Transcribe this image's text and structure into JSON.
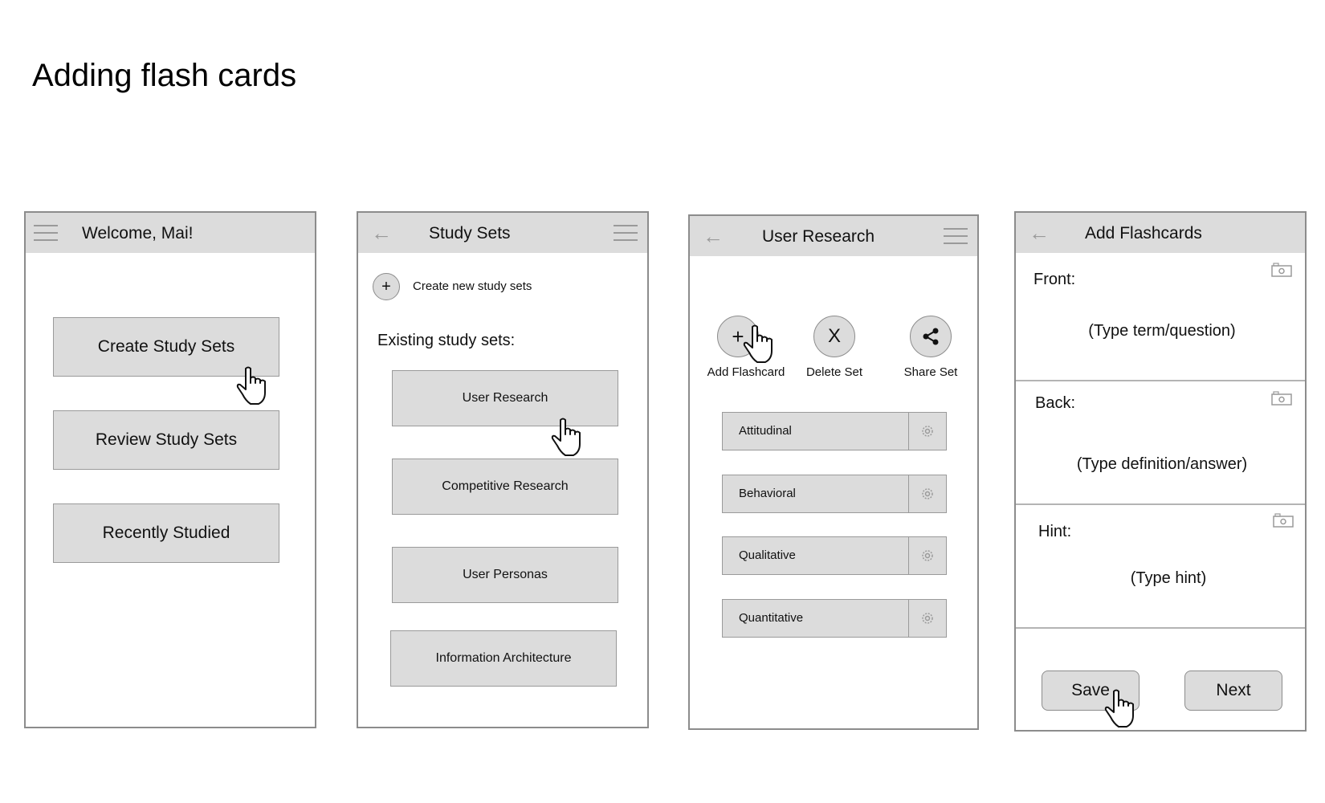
{
  "page": {
    "title": "Adding flash cards"
  },
  "screen1": {
    "header_title": "Welcome, Mai!",
    "buttons": [
      "Create Study Sets",
      "Review Study Sets",
      "Recently Studied"
    ]
  },
  "screen2": {
    "header_title": "Study Sets",
    "create_label": "Create new study sets",
    "create_symbol": "+",
    "existing_label": "Existing study sets:",
    "sets": [
      "User Research",
      "Competitive Research",
      "User Personas",
      "Information Architecture"
    ]
  },
  "screen3": {
    "header_title": "User Research",
    "actions": [
      {
        "symbol": "+",
        "label": "Add Flashcard"
      },
      {
        "symbol": "X",
        "label": "Delete Set"
      },
      {
        "symbol": "",
        "label": "Share Set"
      }
    ],
    "cards": [
      "Attitudinal",
      "Behavioral",
      "Qualitative",
      "Quantitative"
    ]
  },
  "screen4": {
    "header_title": "Add Flashcards",
    "front_label": "Front:",
    "front_placeholder": "(Type term/question)",
    "back_label": "Back:",
    "back_placeholder": "(Type definition/answer)",
    "hint_label": "Hint:",
    "hint_placeholder": "(Type hint)",
    "save_label": "Save",
    "next_label": "Next"
  },
  "colors": {
    "header_bg": "#dcdcdc",
    "button_bg": "#dcdcdc",
    "border": "#8c8c8c"
  },
  "icons": [
    "hamburger-icon",
    "back-arrow-icon",
    "plus-icon",
    "share-icon",
    "gear-icon",
    "camera-icon",
    "hand-cursor-icon"
  ]
}
